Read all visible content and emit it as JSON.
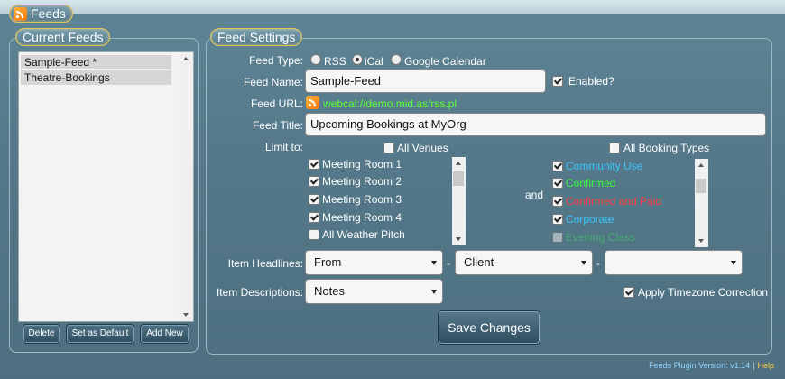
{
  "window": {
    "title": "Feeds"
  },
  "left": {
    "title": "Current Feeds",
    "feeds": [
      "Sample-Feed *",
      "Theatre-Bookings"
    ],
    "buttons": {
      "delete": "Delete",
      "set_default": "Set as Default",
      "add_new": "Add New"
    }
  },
  "right": {
    "title": "Feed Settings",
    "feed_type": {
      "label": "Feed Type:",
      "options": [
        "RSS",
        "iCal",
        "Google Calendar"
      ],
      "selected": "iCal"
    },
    "feed_name": {
      "label": "Feed Name:",
      "value": "Sample-Feed"
    },
    "enabled": {
      "label": "Enabled?",
      "checked": true
    },
    "feed_url": {
      "label": "Feed URL:",
      "value": "webcal://demo.mid.as/rss.pl"
    },
    "feed_title": {
      "label": "Feed Title:",
      "value": "Upcoming Bookings at MyOrg"
    },
    "limit_to": {
      "label": "Limit to:",
      "all_venues": "All Venues",
      "venues": [
        {
          "name": "Meeting Room 1",
          "checked": true
        },
        {
          "name": "Meeting Room 2",
          "checked": true
        },
        {
          "name": "Meeting Room 3",
          "checked": true
        },
        {
          "name": "Meeting Room 4",
          "checked": true
        },
        {
          "name": "All Weather Pitch",
          "checked": false
        }
      ],
      "and": "and",
      "all_booking_types": "All Booking Types",
      "booking_types": [
        {
          "name": "Community Use",
          "checked": true,
          "color": "#38c8ff"
        },
        {
          "name": "Confirmed",
          "checked": true,
          "color": "#35ff35"
        },
        {
          "name": "Confirmed and Paid",
          "checked": true,
          "color": "#ff4040"
        },
        {
          "name": "Corporate",
          "checked": true,
          "color": "#38c8ff"
        },
        {
          "name": "Evening Class",
          "checked": false,
          "color": "#3ecf62"
        }
      ]
    },
    "item_headlines": {
      "label": "Item Headlines:",
      "values": [
        "From",
        "Client",
        ""
      ],
      "separator": "-"
    },
    "item_descriptions": {
      "label": "Item Descriptions:",
      "value": "Notes"
    },
    "timezone": {
      "label": "Apply Timezone Correction",
      "checked": true
    },
    "save": "Save Changes"
  },
  "footer": {
    "version": "Feeds Plugin Version: v1.14",
    "separator": "|",
    "help": "Help"
  }
}
